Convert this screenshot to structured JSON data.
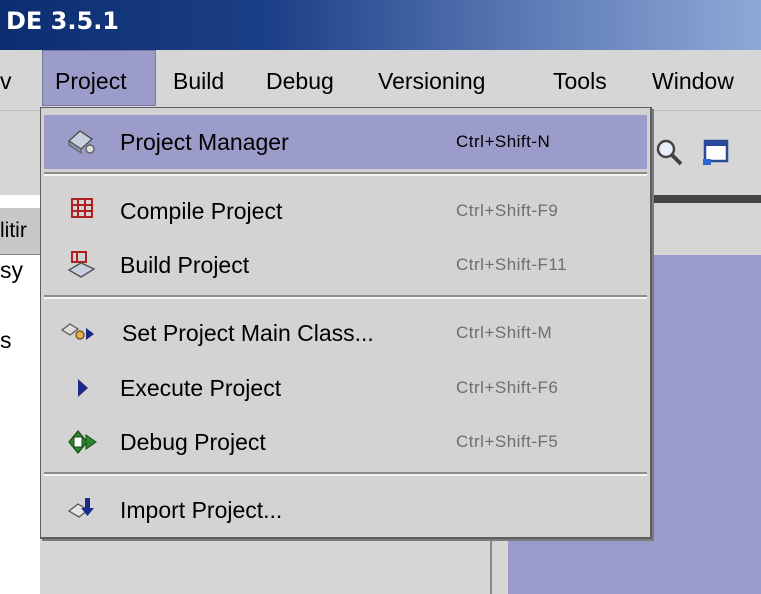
{
  "title": "DE 3.5.1",
  "menubar": {
    "items": [
      "v",
      "Project",
      "Build",
      "Debug",
      "Versioning",
      "Tools",
      "Window"
    ],
    "open": "Project"
  },
  "left_panel": {
    "tab": "litir",
    "row1": "sy",
    "row2": "s"
  },
  "menu": {
    "items": [
      {
        "label": "Project Manager",
        "shortcut": "Ctrl+Shift-N",
        "icon": "project-manager-icon",
        "selected": true
      },
      {
        "label": "Compile Project",
        "shortcut": "Ctrl+Shift-F9",
        "icon": "compile-project-icon"
      },
      {
        "label": "Build Project",
        "shortcut": "Ctrl+Shift-F11",
        "icon": "build-project-icon"
      },
      {
        "label": "Set Project Main Class...",
        "shortcut": "Ctrl+Shift-M",
        "icon": "set-main-class-icon"
      },
      {
        "label": "Execute Project",
        "shortcut": "Ctrl+Shift-F6",
        "icon": "execute-project-icon"
      },
      {
        "label": "Debug Project",
        "shortcut": "Ctrl+Shift-F5",
        "icon": "debug-project-icon"
      },
      {
        "label": "Import Project...",
        "shortcut": "",
        "icon": "import-project-icon"
      }
    ]
  },
  "colors": {
    "selection": "#9c9cca",
    "menu_bg": "#d3d3d3",
    "titlebar": "#1b3f86"
  }
}
